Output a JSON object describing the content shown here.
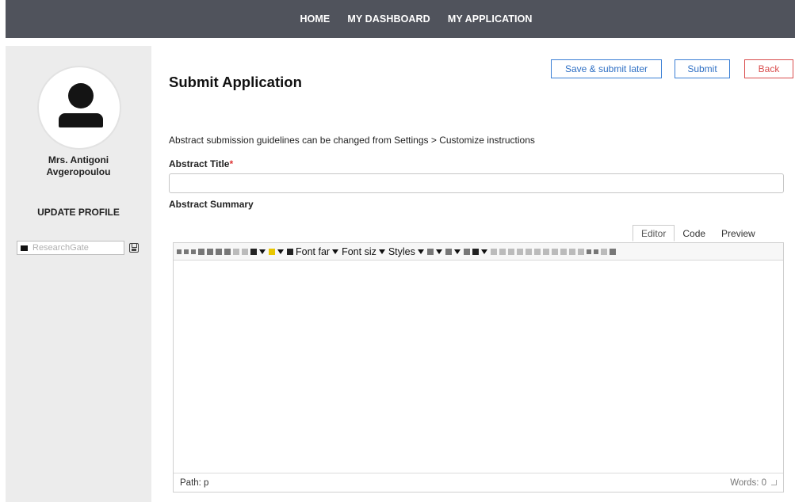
{
  "nav": {
    "items": [
      "HOME",
      "MY DASHBOARD",
      "MY APPLICATION"
    ]
  },
  "sidebar": {
    "user_name": "Mrs. Antigoni\nAvgeropoulou",
    "update_profile": "UPDATE PROFILE",
    "researchgate_placeholder": "ResearchGate"
  },
  "main": {
    "title": "Submit Application",
    "buttons": {
      "save_later": "Save & submit later",
      "submit": "Submit",
      "back": "Back"
    },
    "guidelines": "Abstract submission guidelines can be changed from Settings > Customize instructions",
    "abstract_title_label": "Abstract Title",
    "required_marker": "*",
    "abstract_title_value": "",
    "abstract_summary_label": "Abstract Summary"
  },
  "editor": {
    "tabs": [
      "Editor",
      "Code",
      "Preview"
    ],
    "active_tab": "Editor",
    "toolbar": {
      "font_family": "Font far",
      "font_size": "Font siz",
      "styles": "Styles"
    },
    "path": "Path: p",
    "words": "Words: 0"
  },
  "colors": {
    "nav_bg": "#50535c",
    "sidebar_bg": "#ececec",
    "accent_blue": "#3a7fd5",
    "back_red": "#d94c4c"
  }
}
